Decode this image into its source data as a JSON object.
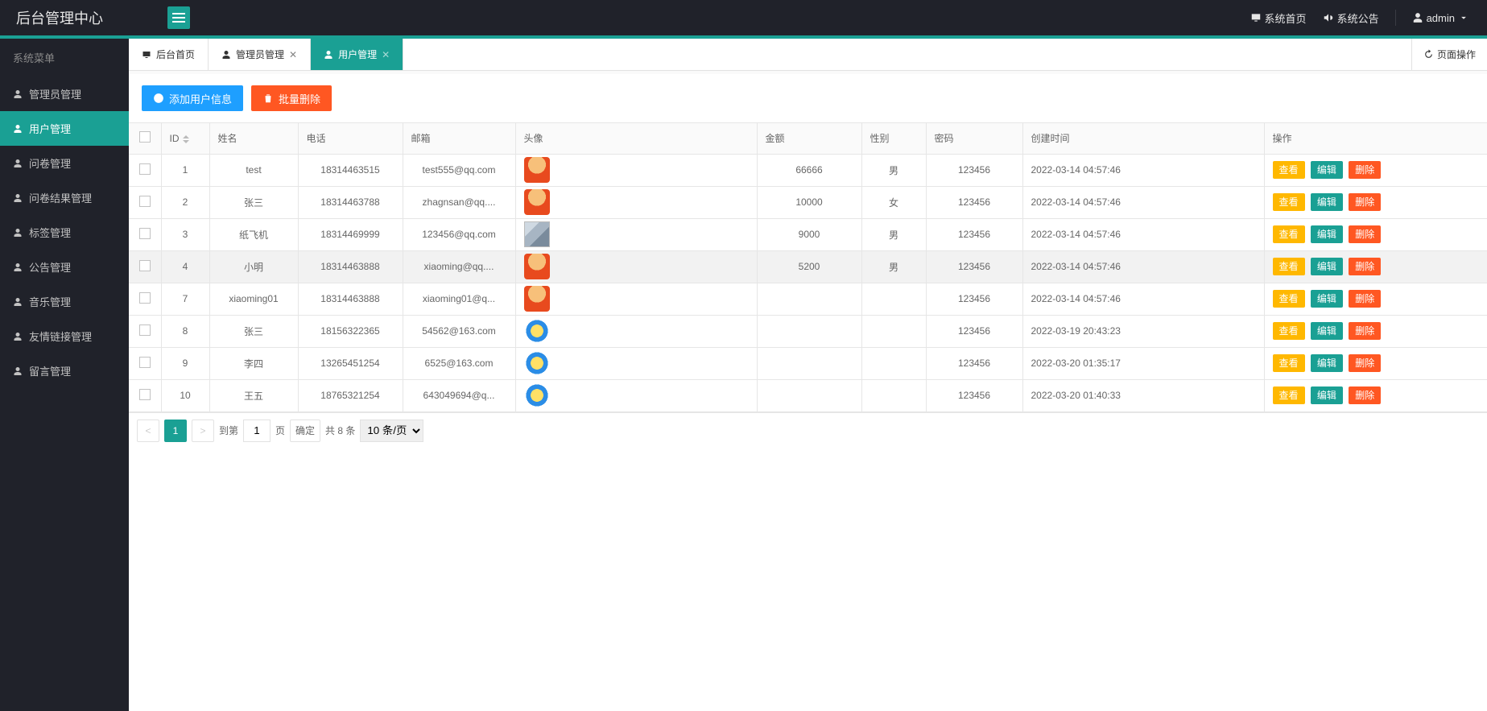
{
  "app_title": "后台管理中心",
  "header_links": {
    "home": "系统首页",
    "notice": "系统公告",
    "user": "admin"
  },
  "sidebar": {
    "title": "系统菜单",
    "items": [
      {
        "label": "管理员管理",
        "icon": "user-icon",
        "active": false
      },
      {
        "label": "用户管理",
        "icon": "user-icon",
        "active": true
      },
      {
        "label": "问卷管理",
        "icon": "doc-icon",
        "active": false
      },
      {
        "label": "问卷结果管理",
        "icon": "doc-icon",
        "active": false
      },
      {
        "label": "标签管理",
        "icon": "user-icon",
        "active": false
      },
      {
        "label": "公告管理",
        "icon": "user-icon",
        "active": false
      },
      {
        "label": "音乐管理",
        "icon": "user-icon",
        "active": false
      },
      {
        "label": "友情链接管理",
        "icon": "user-icon",
        "active": false
      },
      {
        "label": "留言管理",
        "icon": "user-icon",
        "active": false
      }
    ]
  },
  "tabs": [
    {
      "label": "后台首页",
      "icon": "monitor-icon",
      "closable": false,
      "active": false
    },
    {
      "label": "管理员管理",
      "icon": "user-icon",
      "closable": true,
      "active": false
    },
    {
      "label": "用户管理",
      "icon": "user-icon",
      "closable": true,
      "active": true
    }
  ],
  "page_ops": "页面操作",
  "toolbar": {
    "add_label": "添加用户信息",
    "del_label": "批量删除"
  },
  "columns": {
    "id": "ID",
    "name": "姓名",
    "phone": "电话",
    "email": "邮箱",
    "avatar": "头像",
    "amount": "金额",
    "gender": "性别",
    "password": "密码",
    "created": "创建时间",
    "ops": "操作"
  },
  "ops_labels": {
    "view": "查看",
    "edit": "编辑",
    "delete": "删除"
  },
  "rows": [
    {
      "id": "1",
      "name": "test",
      "phone": "18314463515",
      "email": "test555@qq.com",
      "avatar": "a1",
      "amount": "66666",
      "gender": "男",
      "password": "123456",
      "created": "2022-03-14 04:57:46",
      "selected": false
    },
    {
      "id": "2",
      "name": "张三",
      "phone": "18314463788",
      "email": "zhagnsan@qq....",
      "avatar": "a1",
      "amount": "10000",
      "gender": "女",
      "password": "123456",
      "created": "2022-03-14 04:57:46",
      "selected": false
    },
    {
      "id": "3",
      "name": "纸飞机",
      "phone": "18314469999",
      "email": "123456@qq.com",
      "avatar": "a2",
      "amount": "9000",
      "gender": "男",
      "password": "123456",
      "created": "2022-03-14 04:57:46",
      "selected": false
    },
    {
      "id": "4",
      "name": "小明",
      "phone": "18314463888",
      "email": "xiaoming@qq....",
      "avatar": "a1",
      "amount": "5200",
      "gender": "男",
      "password": "123456",
      "created": "2022-03-14 04:57:46",
      "selected": true
    },
    {
      "id": "7",
      "name": "xiaoming01",
      "phone": "18314463888",
      "email": "xiaoming01@q...",
      "avatar": "a1",
      "amount": "",
      "gender": "",
      "password": "123456",
      "created": "2022-03-14 04:57:46",
      "selected": false
    },
    {
      "id": "8",
      "name": "张三",
      "phone": "18156322365",
      "email": "54562@163.com",
      "avatar": "a3",
      "amount": "",
      "gender": "",
      "password": "123456",
      "created": "2022-03-19 20:43:23",
      "selected": false
    },
    {
      "id": "9",
      "name": "李四",
      "phone": "13265451254",
      "email": "6525@163.com",
      "avatar": "a3",
      "amount": "",
      "gender": "",
      "password": "123456",
      "created": "2022-03-20 01:35:17",
      "selected": false
    },
    {
      "id": "10",
      "name": "王五",
      "phone": "18765321254",
      "email": "643049694@q...",
      "avatar": "a3",
      "amount": "",
      "gender": "",
      "password": "123456",
      "created": "2022-03-20 01:40:33",
      "selected": false
    }
  ],
  "pager": {
    "current": "1",
    "jump_label": "到第",
    "page_unit": "页",
    "confirm": "确定",
    "total_text": "共 8 条",
    "per_page": "10 条/页",
    "jump_value": "1"
  }
}
